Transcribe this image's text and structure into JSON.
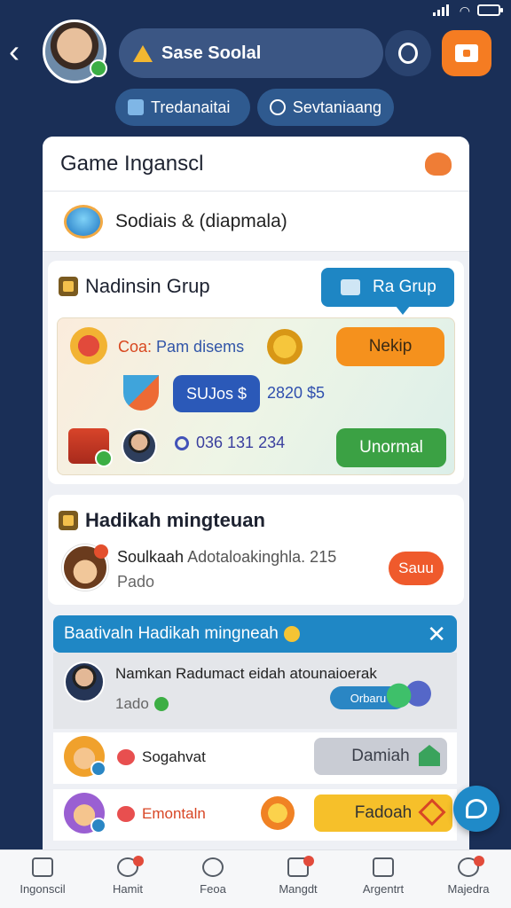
{
  "header": {
    "title": "Sase Soolal",
    "chips": [
      {
        "label": "Tredanaitai"
      },
      {
        "label": "Sevtaniaang"
      }
    ]
  },
  "panel": {
    "title": "Game Inganscl",
    "social_row": "Sodiais & (diapmala)",
    "card1": {
      "title": "Nadinsin Grup",
      "ra_button": "Ra Grup",
      "game_title_prefix": "Coa:",
      "game_title": "Pam disems",
      "nekip_button": "Nekip",
      "sujos_button": "SUJos $",
      "price": "2820 $5",
      "phone": "036 131 234",
      "unormal_button": "Unormal"
    },
    "card2": {
      "title": "Hadikah mingteuan",
      "message_name": "Soulkaah",
      "message_text": "Adotaloakinghla. 215",
      "sub": "Pado",
      "save_button": "Sauu"
    },
    "banner": {
      "text": "Baativaln Hadikah mingneah"
    },
    "news_row": {
      "text": "Namkan Radumact eidah atounaioerak",
      "sub": "1ado",
      "pill": "Orbaru"
    },
    "row_a": {
      "label": "Sogahvat",
      "button": "Damiah"
    },
    "row_b": {
      "label": "Emontaln",
      "button": "Fadoah"
    }
  },
  "bottom_nav": [
    {
      "label": "Ingonscil"
    },
    {
      "label": "Hamit"
    },
    {
      "label": "Feoa"
    },
    {
      "label": "Mangdt"
    },
    {
      "label": "Argentrt"
    },
    {
      "label": "Majedra"
    }
  ]
}
